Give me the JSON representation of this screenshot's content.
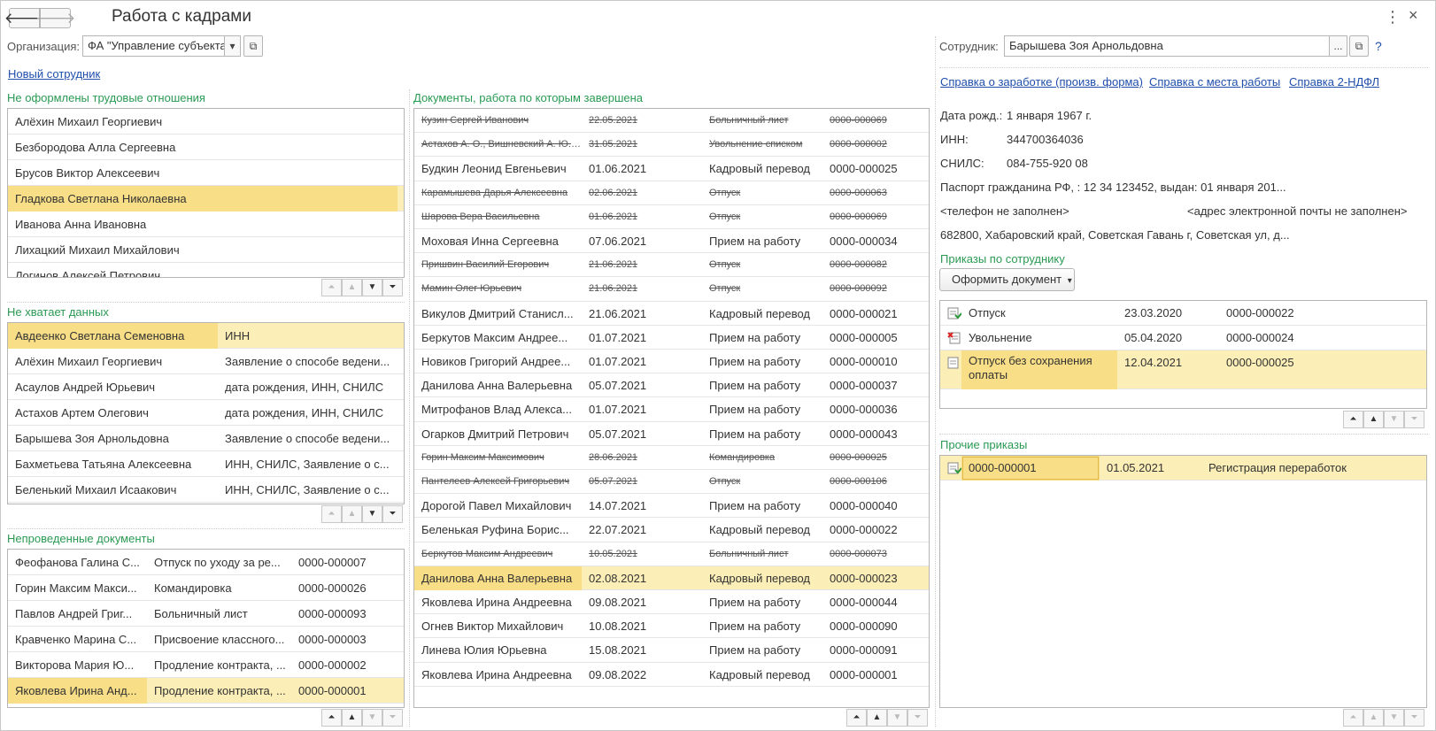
{
  "header": {
    "title": "Работа с кадрами",
    "back_icon": "arrow-left-icon",
    "forward_icon": "arrow-right-icon",
    "more_icon": "more-vertical-icon",
    "close_icon": "close-icon",
    "back_glyph": "🡐",
    "forward_glyph": "🡒",
    "more_glyph": "⋮",
    "close_glyph": "×"
  },
  "org": {
    "label": "Организация:",
    "value": "ФА \"Управление субъекта",
    "dropdown_glyph": "▾",
    "open_glyph": "⧉"
  },
  "new_employee_link": "Новый сотрудник",
  "not_formalized": {
    "title": "Не оформлены трудовые отношения",
    "rows": [
      "Алёхин Михаил Георгиевич",
      "Безбородова Алла Сергеевна",
      "Брусов Виктор Алексеевич",
      "Гладкова Светлана Николаевна",
      "Иванова Анна Ивановна",
      "Лихацкий Михаил Михайлович",
      "Логинов Алексей Петрович"
    ],
    "selected_index": 3
  },
  "missing_data": {
    "title": "Не хватает данных",
    "rows": [
      {
        "name": "Авдеенко Светлана Семеновна",
        "missing": "ИНН"
      },
      {
        "name": "Алёхин Михаил Георгиевич",
        "missing": "Заявление о способе ведени..."
      },
      {
        "name": "Асаулов Андрей Юрьевич",
        "missing": "дата рождения, ИНН, СНИЛС"
      },
      {
        "name": "Астахов Артем Олегович",
        "missing": "дата рождения, ИНН, СНИЛС"
      },
      {
        "name": "Барышева Зоя Арнольдовна",
        "missing": "Заявление о способе ведени..."
      },
      {
        "name": "Бахметьева Татьяна Алексеевна",
        "missing": "ИНН, СНИЛС, Заявление о с..."
      },
      {
        "name": "Беленький Михаил Исаакович",
        "missing": "ИНН, СНИЛС, Заявление о с..."
      }
    ],
    "selected_index": 0
  },
  "unposted": {
    "title": "Непроведенные документы",
    "rows": [
      {
        "name": "Феофанова Галина С...",
        "doc": "Отпуск по уходу за ре...",
        "num": "0000-000007"
      },
      {
        "name": "Горин Максим Макси...",
        "doc": "Командировка",
        "num": "0000-000026"
      },
      {
        "name": "Павлов Андрей Григ...",
        "doc": "Больничный лист",
        "num": "0000-000093"
      },
      {
        "name": "Кравченко Марина С...",
        "doc": "Присвоение классного...",
        "num": "0000-000003"
      },
      {
        "name": "Викторова Мария Ю...",
        "doc": "Продление контракта, ...",
        "num": "0000-000002"
      },
      {
        "name": "Яковлева Ирина Анд...",
        "doc": "Продление контракта, ...",
        "num": "0000-000001"
      }
    ],
    "selected_index": 5
  },
  "completed": {
    "title": "Документы, работа по которым завершена",
    "rows": [
      {
        "name": "Кузин Сергей Иванович",
        "date": "22.05.2021",
        "doc": "Больничный лист",
        "num": "0000-000069",
        "deleted": true
      },
      {
        "name": "Астахов А. О., Вишневский А. Ю.,...",
        "date": "31.05.2021",
        "doc": "Увольнение списком",
        "num": "0000-000002",
        "deleted": true
      },
      {
        "name": "Будкин Леонид Евгеньевич",
        "date": "01.06.2021",
        "doc": "Кадровый перевод",
        "num": "0000-000025",
        "deleted": false
      },
      {
        "name": "Карамышева Дарья Алексеевна",
        "date": "02.06.2021",
        "doc": "Отпуск",
        "num": "0000-000063",
        "deleted": true
      },
      {
        "name": "Шарова Вера Васильевна",
        "date": "01.06.2021",
        "doc": "Отпуск",
        "num": "0000-000069",
        "deleted": true
      },
      {
        "name": "Моховая Инна Сергеевна",
        "date": "07.06.2021",
        "doc": "Прием на работу",
        "num": "0000-000034",
        "deleted": false
      },
      {
        "name": "Пришвин Василий Егорович",
        "date": "21.06.2021",
        "doc": "Отпуск",
        "num": "0000-000082",
        "deleted": true
      },
      {
        "name": "Мамин Олег Юрьевич",
        "date": "21.06.2021",
        "doc": "Отпуск",
        "num": "0000-000092",
        "deleted": true
      },
      {
        "name": "Викулов Дмитрий Станисл...",
        "date": "21.06.2021",
        "doc": "Кадровый перевод",
        "num": "0000-000021",
        "deleted": false
      },
      {
        "name": "Беркутов Максим Андрее...",
        "date": "01.07.2021",
        "doc": "Прием на работу",
        "num": "0000-000005",
        "deleted": false
      },
      {
        "name": "Новиков Григорий Андрее...",
        "date": "01.07.2021",
        "doc": "Прием на работу",
        "num": "0000-000010",
        "deleted": false
      },
      {
        "name": "Данилова Анна Валерьевна",
        "date": "05.07.2021",
        "doc": "Прием на работу",
        "num": "0000-000037",
        "deleted": false
      },
      {
        "name": "Митрофанов Влад Алекса...",
        "date": "01.07.2021",
        "doc": "Прием на работу",
        "num": "0000-000036",
        "deleted": false
      },
      {
        "name": "Огарков Дмитрий Петрович",
        "date": "05.07.2021",
        "doc": "Прием на работу",
        "num": "0000-000043",
        "deleted": false
      },
      {
        "name": "Горин Максим Максимович",
        "date": "28.06.2021",
        "doc": "Командировка",
        "num": "0000-000025",
        "deleted": true
      },
      {
        "name": "Пантелеев Алексей Григорьевич",
        "date": "05.07.2021",
        "doc": "Отпуск",
        "num": "0000-000106",
        "deleted": true
      },
      {
        "name": "Дорогой Павел Михайлович",
        "date": "14.07.2021",
        "doc": "Прием на работу",
        "num": "0000-000040",
        "deleted": false
      },
      {
        "name": "Беленькая Руфина Борис...",
        "date": "22.07.2021",
        "doc": "Кадровый перевод",
        "num": "0000-000022",
        "deleted": false
      },
      {
        "name": "Беркутов Максим Андреевич",
        "date": "10.05.2021",
        "doc": "Больничный лист",
        "num": "0000-000073",
        "deleted": true
      },
      {
        "name": "Данилова Анна Валерьевна",
        "date": "02.08.2021",
        "doc": "Кадровый перевод",
        "num": "0000-000023",
        "deleted": false
      },
      {
        "name": "Яковлева Ирина Андреевна",
        "date": "09.08.2021",
        "doc": "Прием на работу",
        "num": "0000-000044",
        "deleted": false
      },
      {
        "name": "Огнев Виктор Михайлович",
        "date": "10.08.2021",
        "doc": "Прием на работу",
        "num": "0000-000090",
        "deleted": false
      },
      {
        "name": "Линева Юлия Юрьевна",
        "date": "15.08.2021",
        "doc": "Прием на работу",
        "num": "0000-000091",
        "deleted": false
      },
      {
        "name": "Яковлева Ирина Андреевна",
        "date": "09.08.2022",
        "doc": "Кадровый перевод",
        "num": "0000-000001",
        "deleted": false
      }
    ],
    "selected_index": 19
  },
  "employee": {
    "label": "Сотрудник:",
    "value": "Барышева Зоя Арнольдовна",
    "select_glyph": "...",
    "open_glyph": "⧉",
    "help_glyph": "?"
  },
  "links": {
    "salary_ref": "Справка о заработке (произв. форма)",
    "workplace_ref": "Справка с места работы",
    "ndfl_ref": "Справка 2-НДФЛ"
  },
  "info": {
    "birth_label": "Дата рожд.:",
    "birth_value": "1 января 1967 г.",
    "inn_label": "ИНН:",
    "inn_value": "344700364036",
    "snils_label": "СНИЛС:",
    "snils_value": "084-755-920 08",
    "passport": "Паспорт гражданина РФ, : 12 34 123452, выдан: 01 января 201...",
    "phone": "<телефон не заполнен>",
    "email": "<адрес электронной почты не заполнен>",
    "address": "682800, Хабаровский край, Советская Гавань г, Советская ул, д..."
  },
  "orders": {
    "title": "Приказы по сотруднику",
    "create_button": "Оформить документ",
    "create_glyph": "▾",
    "rows": [
      {
        "icon": "document-posted-icon",
        "type": "Отпуск",
        "date": "23.03.2020",
        "num": "0000-000022"
      },
      {
        "icon": "document-cancel-icon",
        "type": "Увольнение",
        "date": "05.04.2020",
        "num": "0000-000024"
      },
      {
        "icon": "document-icon",
        "type": "Отпуск без сохранения оплаты",
        "date": "12.04.2021",
        "num": "0000-000025"
      }
    ],
    "selected_index": 2
  },
  "other_orders": {
    "title": "Прочие приказы",
    "rows": [
      {
        "icon": "document-posted-icon",
        "num": "0000-000001",
        "date": "01.05.2021",
        "type": "Регистрация переработок"
      }
    ],
    "selected_index": 0
  },
  "scroll_icons": {
    "top": "scroll-to-top-icon",
    "up": "scroll-up-icon",
    "down": "scroll-down-icon",
    "bottom": "scroll-to-bottom-icon",
    "top_glyph": "⏶",
    "up_glyph": "▲",
    "down_glyph": "▼",
    "bottom_glyph": "⏷"
  },
  "colors": {
    "accent_green": "#2a9a53",
    "link_blue": "#1f4eac",
    "selection": "#fbeeb7",
    "selection_cell": "#f8de86"
  }
}
